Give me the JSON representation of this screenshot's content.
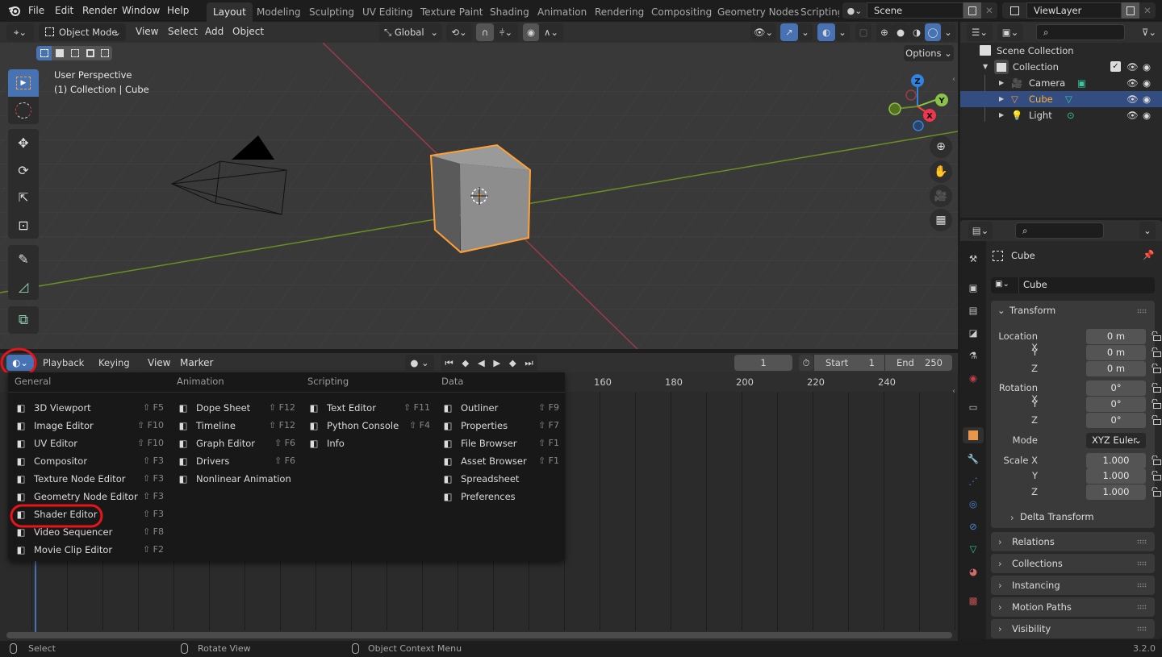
{
  "top_menu": [
    "File",
    "Edit",
    "Render",
    "Window",
    "Help"
  ],
  "workspaces": {
    "active": "Layout",
    "tabs": [
      "Layout",
      "Modeling",
      "Sculpting",
      "UV Editing",
      "Texture Paint",
      "Shading",
      "Animation",
      "Rendering",
      "Compositing",
      "Geometry Nodes",
      "Scripting"
    ]
  },
  "scene": {
    "name": "Scene",
    "view_layer": "ViewLayer"
  },
  "viewport_header": {
    "mode": "Object Mode",
    "menus": [
      "View",
      "Select",
      "Add",
      "Object"
    ],
    "orientation": "Global",
    "options_label": "Options"
  },
  "viewport": {
    "view_name": "User Perspective",
    "collection_info": "(1) Collection | Cube",
    "gizmo_axes": {
      "z": "Z",
      "y": "Y",
      "x": "X"
    }
  },
  "timeline_header": {
    "menus": [
      "Playback",
      "Keying",
      "View",
      "Marker"
    ],
    "current_frame": "1",
    "start_label": "Start",
    "start": "1",
    "end_label": "End",
    "end": "250"
  },
  "timeline_ruler": [
    "160",
    "180",
    "200",
    "220",
    "240"
  ],
  "editor_type_menu": {
    "columns": [
      {
        "title": "General",
        "items": [
          {
            "label": "3D Viewport",
            "shortcut": "⇧ F5",
            "icon": "viewport-3d-icon"
          },
          {
            "label": "Image Editor",
            "shortcut": "⇧ F10",
            "icon": "image-editor-icon"
          },
          {
            "label": "UV Editor",
            "shortcut": "⇧ F10",
            "icon": "uv-editor-icon"
          },
          {
            "label": "Compositor",
            "shortcut": "⇧ F3",
            "icon": "compositor-icon"
          },
          {
            "label": "Texture Node Editor",
            "shortcut": "⇧ F3",
            "icon": "texture-node-icon"
          },
          {
            "label": "Geometry Node Editor",
            "shortcut": "⇧ F3",
            "icon": "geometry-node-icon"
          },
          {
            "label": "Shader Editor",
            "shortcut": "⇧ F3",
            "icon": "shader-editor-icon",
            "highlighted": true
          },
          {
            "label": "Video Sequencer",
            "shortcut": "⇧ F8",
            "icon": "video-sequencer-icon"
          },
          {
            "label": "Movie Clip Editor",
            "shortcut": "⇧ F2",
            "icon": "movie-clip-icon"
          }
        ]
      },
      {
        "title": "Animation",
        "items": [
          {
            "label": "Dope Sheet",
            "shortcut": "⇧ F12",
            "icon": "dope-sheet-icon"
          },
          {
            "label": "Timeline",
            "shortcut": "⇧ F12",
            "icon": "timeline-icon"
          },
          {
            "label": "Graph Editor",
            "shortcut": "⇧ F6",
            "icon": "graph-editor-icon"
          },
          {
            "label": "Drivers",
            "shortcut": "⇧ F6",
            "icon": "drivers-icon"
          },
          {
            "label": "Nonlinear Animation",
            "shortcut": "",
            "icon": "nla-icon"
          }
        ]
      },
      {
        "title": "Scripting",
        "items": [
          {
            "label": "Text Editor",
            "shortcut": "⇧ F11",
            "icon": "text-editor-icon"
          },
          {
            "label": "Python Console",
            "shortcut": "⇧ F4",
            "icon": "python-console-icon"
          },
          {
            "label": "Info",
            "shortcut": "",
            "icon": "info-icon"
          }
        ]
      },
      {
        "title": "Data",
        "items": [
          {
            "label": "Outliner",
            "shortcut": "⇧ F9",
            "icon": "outliner-icon"
          },
          {
            "label": "Properties",
            "shortcut": "⇧ F7",
            "icon": "properties-icon"
          },
          {
            "label": "File Browser",
            "shortcut": "⇧ F1",
            "icon": "file-browser-icon"
          },
          {
            "label": "Asset Browser",
            "shortcut": "⇧ F1",
            "icon": "asset-browser-icon"
          },
          {
            "label": "Spreadsheet",
            "shortcut": "",
            "icon": "spreadsheet-icon"
          },
          {
            "label": "Preferences",
            "shortcut": "",
            "icon": "preferences-icon"
          }
        ]
      }
    ]
  },
  "outliner": {
    "root": "Scene Collection",
    "collection": "Collection",
    "objects": [
      {
        "name": "Camera",
        "selected": false
      },
      {
        "name": "Cube",
        "selected": true
      },
      {
        "name": "Light",
        "selected": false
      }
    ]
  },
  "properties": {
    "object_name": "Cube",
    "data_name": "Cube",
    "transform_title": "Transform",
    "location": {
      "label": "Location X",
      "x": "0 m",
      "y": "0 m",
      "z": "0 m"
    },
    "rotation": {
      "label": "Rotation X",
      "x": "0°",
      "y": "0°",
      "z": "0°"
    },
    "mode_label": "Mode",
    "mode": "XYZ Euler",
    "scale": {
      "label": "Scale X",
      "x": "1.000",
      "y": "1.000",
      "z": "1.000"
    },
    "axis_labels": {
      "y": "Y",
      "z": "Z"
    },
    "delta": "Delta Transform",
    "collapsed_panels": [
      "Relations",
      "Collections",
      "Instancing",
      "Motion Paths",
      "Visibility"
    ]
  },
  "status_bar": {
    "select": "Select",
    "rotate": "Rotate View",
    "context": "Object Context Menu",
    "version": "3.2.0"
  },
  "colors": {
    "accent": "#4772b3",
    "selection": "#ffa033",
    "annotation": "#e8141c"
  }
}
